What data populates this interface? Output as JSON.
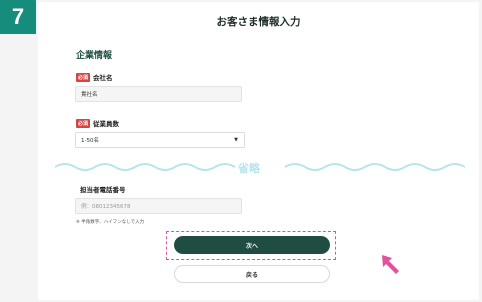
{
  "step_number": "7",
  "page_title": "お客さま情報入力",
  "section_title": "企業情報",
  "company": {
    "required_badge": "必須",
    "label": "会社名",
    "value": "貴社名"
  },
  "employees": {
    "required_badge": "必須",
    "label": "従業員数",
    "selected": "1-50名"
  },
  "omitted_label": "省略",
  "phone": {
    "label": "担当者電話番号",
    "placeholder": "例：08012345678",
    "note": "※ 半角数字、ハイフンなしで入力"
  },
  "buttons": {
    "next": "次へ",
    "back": "戻る"
  },
  "colors": {
    "badge": "#168c7d",
    "primary": "#1f4d44",
    "required": "#d64545",
    "highlight": "#e0529b",
    "wave": "#b8e4ee"
  }
}
